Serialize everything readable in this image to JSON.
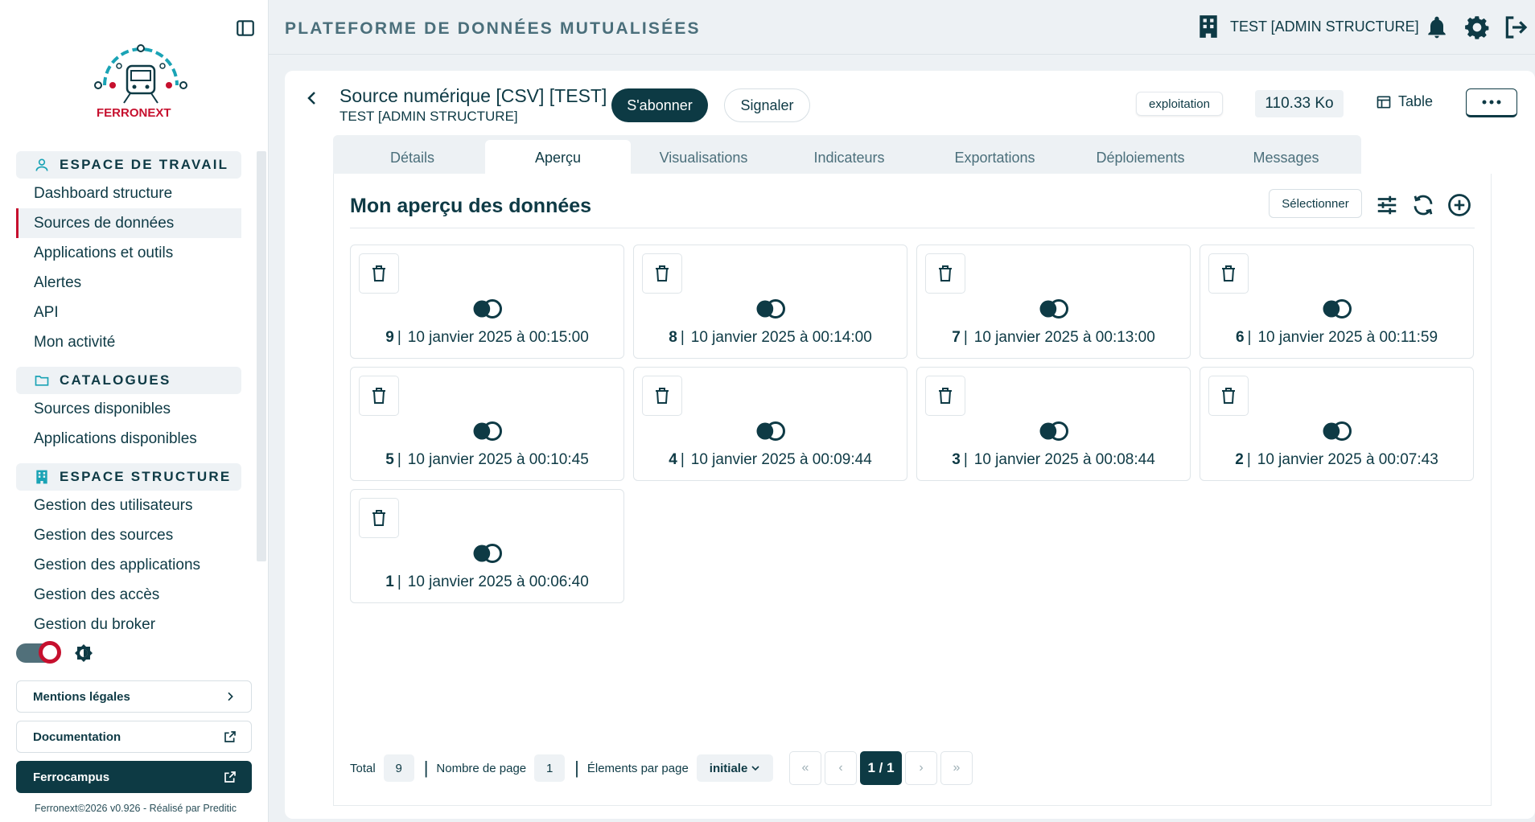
{
  "app": {
    "title": "PLATEFORME DE DONNÉES MUTUALISÉES",
    "user": "TEST [ADMIN STRUCTURE]",
    "logo_text": "FERRONEXT"
  },
  "sidebar": {
    "sections": [
      {
        "title": "ESPACE DE TRAVAIL",
        "icon": "user-icon",
        "items": [
          {
            "label": "Dashboard structure",
            "active": false
          },
          {
            "label": "Sources de données",
            "active": true
          },
          {
            "label": "Applications et outils",
            "active": false
          },
          {
            "label": "Alertes",
            "active": false
          },
          {
            "label": "API",
            "active": false
          },
          {
            "label": "Mon activité",
            "active": false
          }
        ]
      },
      {
        "title": "CATALOGUES",
        "icon": "folder-icon",
        "items": [
          {
            "label": "Sources disponibles",
            "active": false
          },
          {
            "label": "Applications disponibles",
            "active": false
          }
        ]
      },
      {
        "title": "ESPACE STRUCTURE",
        "icon": "building-icon",
        "items": [
          {
            "label": "Gestion des utilisateurs",
            "active": false
          },
          {
            "label": "Gestion des sources",
            "active": false
          },
          {
            "label": "Gestion des applications",
            "active": false
          },
          {
            "label": "Gestion des accès",
            "active": false
          },
          {
            "label": "Gestion du broker",
            "active": false
          }
        ]
      }
    ],
    "links": [
      {
        "label": "Mentions légales",
        "icon": "chevron-right-icon"
      },
      {
        "label": "Documentation",
        "icon": "external-link-icon"
      },
      {
        "label": "Ferrocampus",
        "icon": "external-link-icon"
      }
    ],
    "footer": "Ferronext©2026 v0.926 - Réalisé par Preditic"
  },
  "source": {
    "title": "Source numérique [CSV] [TEST]",
    "owner": "TEST [ADMIN STRUCTURE]",
    "subscribe_label": "S'abonner",
    "report_label": "Signaler",
    "status_badge": "exploitation",
    "size": "110.33 Ko",
    "view_label": "Table"
  },
  "tabs": [
    {
      "label": "Détails",
      "active": false
    },
    {
      "label": "Aperçu",
      "active": true
    },
    {
      "label": "Visualisations",
      "active": false
    },
    {
      "label": "Indicateurs",
      "active": false
    },
    {
      "label": "Exportations",
      "active": false
    },
    {
      "label": "Déploiements",
      "active": false
    },
    {
      "label": "Messages",
      "active": false
    }
  ],
  "preview": {
    "title": "Mon aperçu des données",
    "select_label": "Sélectionner",
    "tiles": [
      {
        "num": "9",
        "date": "10 janvier 2025 à 00:15:00"
      },
      {
        "num": "8",
        "date": "10 janvier 2025 à 00:14:00"
      },
      {
        "num": "7",
        "date": "10 janvier 2025 à 00:13:00"
      },
      {
        "num": "6",
        "date": "10 janvier 2025 à 00:11:59"
      },
      {
        "num": "5",
        "date": "10 janvier 2025 à 00:10:45"
      },
      {
        "num": "4",
        "date": "10 janvier 2025 à 00:09:44"
      },
      {
        "num": "3",
        "date": "10 janvier 2025 à 00:08:44"
      },
      {
        "num": "2",
        "date": "10 janvier 2025 à 00:07:43"
      },
      {
        "num": "1",
        "date": "10 janvier 2025 à 00:06:40"
      }
    ]
  },
  "pagination": {
    "total_label": "Total",
    "total": "9",
    "pages_label": "Nombre de page",
    "pages": "1",
    "per_page_label": "Élements par page",
    "per_page_value": "initiale",
    "first": "«",
    "prev": "‹",
    "current": "1 / 1",
    "next": "›",
    "last": "»"
  },
  "colors": {
    "primary": "#0d3a44",
    "accent": "#c6102e",
    "teal": "#1aa3b5"
  }
}
